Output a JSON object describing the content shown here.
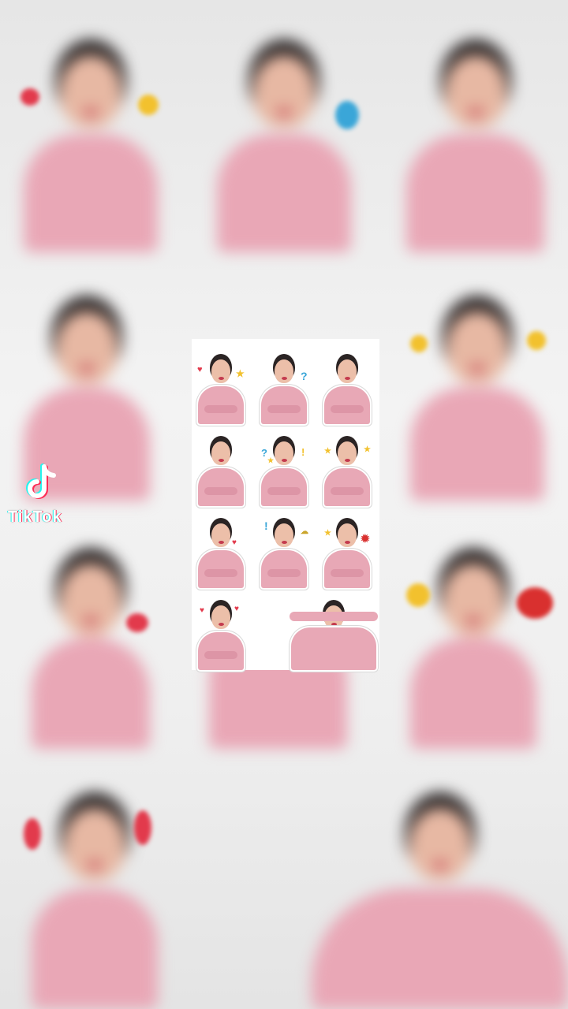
{
  "watermark": {
    "brand_text": "TikTok",
    "logo_icon": "tiktok-note-icon",
    "colors": {
      "cyan": "#25f4ee",
      "pink": "#fe2c55"
    }
  },
  "sticker_sheet": {
    "count": 11,
    "colors": {
      "outfit": "#e8a8b6",
      "hair": "#2b2424",
      "background": "#ffffff"
    },
    "decorations": [
      "heart-icon",
      "star-icon",
      "question-mark-icon",
      "exclamation-icon",
      "pow-burst-icon"
    ]
  }
}
